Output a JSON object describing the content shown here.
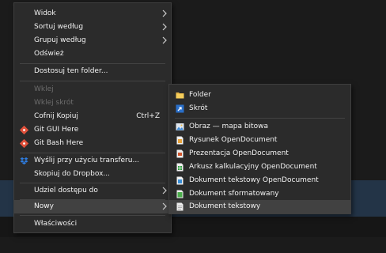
{
  "colors": {
    "menu_bg": "#2b2b2b",
    "separator": "#434343",
    "text": "#f2f2f2",
    "disabled_text": "#6d6d6d",
    "highlight": "#414141"
  },
  "main_menu": {
    "view": "Widok",
    "sort_by": "Sortuj według",
    "group_by": "Grupuj według",
    "refresh": "Odśwież",
    "customize_folder": "Dostosuj ten folder...",
    "paste": "Wklej",
    "paste_shortcut": "Wklej skrót",
    "undo_copy": "Cofnij Kopiuj",
    "undo_shortcut": "Ctrl+Z",
    "git_gui": "Git GUI Here",
    "git_bash": "Git Bash Here",
    "wetransfer": "Wyślij przy użyciu transferu...",
    "dropbox_copy": "Skopiuj do Dropbox...",
    "share_access": "Udziel dostępu do",
    "new": "Nowy",
    "properties": "Właściwości"
  },
  "submenu": {
    "folder": "Folder",
    "shortcut": "Skrót",
    "bitmap": "Obraz — mapa bitowa",
    "od_drawing": "Rysunek OpenDocument",
    "od_presentation": "Prezentacja OpenDocument",
    "od_spreadsheet": "Arkusz kalkulacyjny OpenDocument",
    "od_text": "Dokument tekstowy OpenDocument",
    "rich_text": "Dokument sformatowany",
    "text_document": "Dokument tekstowy"
  },
  "icons": {
    "git_gui": "git-gui-icon",
    "git_bash": "git-bash-icon",
    "dropbox": "dropbox-icon",
    "folder": "folder-icon",
    "shortcut": "shortcut-icon",
    "bitmap": "bitmap-icon",
    "od_drawing": "drawing-icon",
    "od_presentation": "presentation-icon",
    "od_spreadsheet": "spreadsheet-icon",
    "od_text": "text-doc-icon",
    "rich_text": "rich-text-icon",
    "text_document": "plain-text-icon"
  }
}
